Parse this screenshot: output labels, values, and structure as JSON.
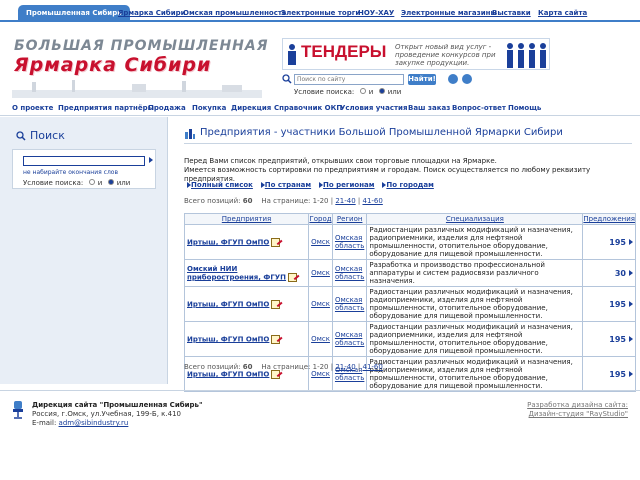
{
  "top_tabs": [
    "Промышленная Сибирь",
    "Ярмарка Сибири",
    "Омская промышленность",
    "Электронные торги",
    "НОУ-ХАУ",
    "Электронные магазины",
    "Выставки",
    "Карта сайта"
  ],
  "logo": {
    "line1": "БОЛЬШАЯ ПРОМЫШЛЕННАЯ",
    "line2": "Ярмарка Сибири"
  },
  "banner": {
    "title": "ТЕНДЕРЫ",
    "text": "Открыт новый вид услуг - проведение конкурсов при закупке продукции."
  },
  "top_search": {
    "placeholder": "Поиск по сайту",
    "button": "Найти!",
    "cond_label": "Условие поиска:",
    "opt_and": "и",
    "opt_or": "или"
  },
  "main_nav": [
    "О проекте",
    "Предприятия партнёры",
    "Продажа",
    "Покупка",
    "Дирекция",
    "Справочник ОКП",
    "Условия участия",
    "Ваш заказ",
    "Вопрос-ответ",
    "Помощь"
  ],
  "sidebar": {
    "title": "Поиск",
    "hint": "не набирайте окончания слов",
    "cond_label": "Условие поиска:",
    "opt_and": "и",
    "opt_or": "или"
  },
  "content": {
    "title": "Предприятия - участники Большой Промышленной Ярмарки Сибири",
    "desc1": "Перед Вами список предприятий, открывших свои торговые площадки на Ярмарке.",
    "desc2": "Имеется возможность сортировки по предприятиям и городам. Поиск осуществляется по любому реквизиту предприятия.",
    "sort_links": [
      "Полный список",
      "По странам",
      "По регионам",
      "По городам"
    ],
    "pager": {
      "total_label": "Всего позиций:",
      "total": "60",
      "page_label": "На странице:",
      "pages": [
        "1-20",
        "21-40",
        "41-60"
      ]
    },
    "columns": [
      "Предприятия",
      "Город",
      "Регион",
      "Специализация",
      "Предложения"
    ],
    "rows": [
      {
        "name": "Иртыш, ФГУП ОмПО",
        "city": "Омск",
        "region": "Омская область",
        "spec": "Радиостанции различных модификаций и назначения, радиоприемники, изделия для нефтяной промышленности, отопительное оборудование, оборудование для пищевой промышленности.",
        "offers": "195"
      },
      {
        "name": "Омский НИИ приборостроения, ФГУП",
        "city": "Омск",
        "region": "Омская область",
        "spec": "Разработка и производство профессиональной аппаратуры и систем радиосвязи различного назначения.",
        "offers": "30"
      },
      {
        "name": "Иртыш, ФГУП ОмПО",
        "city": "Омск",
        "region": "Омская область",
        "spec": "Радиостанции различных модификаций и назначения, радиоприемники, изделия для нефтяной промышленности, отопительное оборудование, оборудование для пищевой промышленности.",
        "offers": "195"
      },
      {
        "name": "Иртыш, ФГУП ОмПО",
        "city": "Омск",
        "region": "Омская область",
        "spec": "Радиостанции различных модификаций и назначения, радиоприемники, изделия для нефтяной промышленности, отопительное оборудование, оборудование для пищевой промышленности.",
        "offers": "195"
      },
      {
        "name": "Иртыш, ФГУП ОмПО",
        "city": "Омск",
        "region": "Омская область",
        "spec": "Радиостанции различных модификаций и назначения, радиоприемники, изделия для нефтяной промышленности, отопительное оборудование, оборудование для пищевой промышленности.",
        "offers": "195"
      }
    ]
  },
  "footer": {
    "title": "Дирекция сайта \"Промышленная Сибирь\"",
    "address": "Россия, г.Омск, ул.Учебная, 199-Б, к.410",
    "email_label": "E-mail:",
    "email": "adm@sibindustry.ru",
    "dev1": "Разработка дизайна сайта:",
    "dev2": "Дизайн-студия \"RayStudio\""
  },
  "colors": {
    "accent": "#3f7ec8",
    "brand_red": "#c8102e",
    "link": "#1a3f9a"
  }
}
